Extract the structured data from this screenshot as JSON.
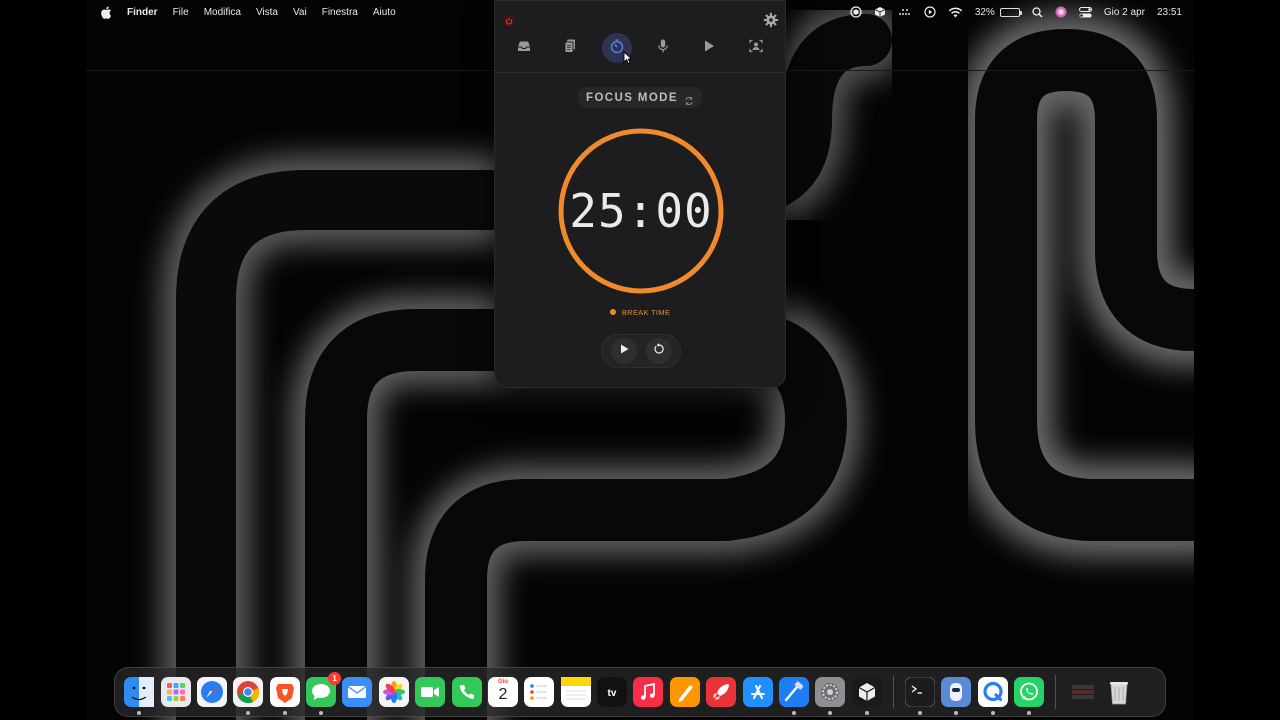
{
  "menubar": {
    "app_name": "Finder",
    "items": [
      "File",
      "Modifica",
      "Vista",
      "Vai",
      "Finestra",
      "Aiuto"
    ],
    "battery_percent": "32%",
    "battery_level": 0.32,
    "date": "Gio 2 apr",
    "time": "23:51"
  },
  "panel": {
    "tabs": [
      {
        "icon": "inbox-icon",
        "active": false
      },
      {
        "icon": "clipboard-icon",
        "active": false
      },
      {
        "icon": "timer-icon",
        "active": true
      },
      {
        "icon": "microphone-icon",
        "active": false
      },
      {
        "icon": "play-icon",
        "active": false
      },
      {
        "icon": "user-frame-icon",
        "active": false
      }
    ],
    "mode_label": "FOCUS MODE",
    "timer": "25:00",
    "progress": 1.0,
    "status_label": "BREAK TIME",
    "accent_color": "#f08a2c"
  },
  "dock": {
    "apps": [
      {
        "name": "Finder",
        "icon": "finder-icon",
        "color": "#2f8cf0",
        "running": true
      },
      {
        "name": "Launchpad",
        "icon": "launchpad-icon",
        "color": "#e9e9ef",
        "running": false
      },
      {
        "name": "Safari",
        "icon": "safari-icon",
        "color": "#2a7df0",
        "running": false
      },
      {
        "name": "Chrome",
        "icon": "chrome-icon",
        "color": "#f2f2f2",
        "running": true
      },
      {
        "name": "Brave",
        "icon": "brave-icon",
        "color": "#fb542b",
        "running": true
      },
      {
        "name": "Messaggi",
        "icon": "messages-icon",
        "color": "#34c759",
        "running": true,
        "badge": "1"
      },
      {
        "name": "Mail",
        "icon": "mail-icon",
        "color": "#3a8ff5",
        "running": false
      },
      {
        "name": "Foto",
        "icon": "photos-icon",
        "color": "#f5f5f5",
        "running": false
      },
      {
        "name": "FaceTime",
        "icon": "facetime-icon",
        "color": "#34c759",
        "running": false
      },
      {
        "name": "Telefono",
        "icon": "phone-icon",
        "color": "#34c759",
        "running": false
      },
      {
        "name": "Calendario",
        "icon": "calendar-icon",
        "color": "#ffffff",
        "running": false,
        "day": "Gio",
        "date": "2"
      },
      {
        "name": "Promemoria",
        "icon": "reminders-icon",
        "color": "#ffffff",
        "running": false
      },
      {
        "name": "Note",
        "icon": "notes-icon",
        "color": "#ffd60a",
        "running": false
      },
      {
        "name": "TV",
        "icon": "tv-icon",
        "color": "#111111",
        "running": false,
        "label": "tv"
      },
      {
        "name": "Musica",
        "icon": "music-icon",
        "color": "#fa2d48",
        "running": false
      },
      {
        "name": "Pages",
        "icon": "pages-icon",
        "color": "#ff9500",
        "running": false
      },
      {
        "name": "RocketSim",
        "icon": "rocket-icon",
        "color": "#e8333a",
        "running": false
      },
      {
        "name": "App Store",
        "icon": "appstore-icon",
        "color": "#1e90ff",
        "running": false
      },
      {
        "name": "Xcode",
        "icon": "xcode-icon",
        "color": "#1c7ef2",
        "running": true
      },
      {
        "name": "Impostazioni",
        "icon": "settings-icon",
        "color": "#8e8e93",
        "running": true
      },
      {
        "name": "Unity",
        "icon": "cube-icon",
        "color": "#1a1a1a",
        "running": true
      }
    ],
    "apps_right": [
      {
        "name": "Terminale",
        "icon": "terminal-icon",
        "color": "#1c1c1e",
        "running": true
      },
      {
        "name": "Ollama",
        "icon": "ollama-icon",
        "color": "#5a8ad6",
        "running": true
      },
      {
        "name": "Quick",
        "icon": "q-icon",
        "color": "#2b7cf6",
        "running": true
      },
      {
        "name": "WhatsApp",
        "icon": "whatsapp-icon",
        "color": "#25d366",
        "running": true
      }
    ],
    "apps_trailing": [
      {
        "name": "Documenti",
        "icon": "stack-icon",
        "color": "#2a2a2c",
        "running": false
      },
      {
        "name": "Cestino",
        "icon": "trash-icon",
        "color": "#cfcfd4",
        "running": false
      }
    ]
  }
}
